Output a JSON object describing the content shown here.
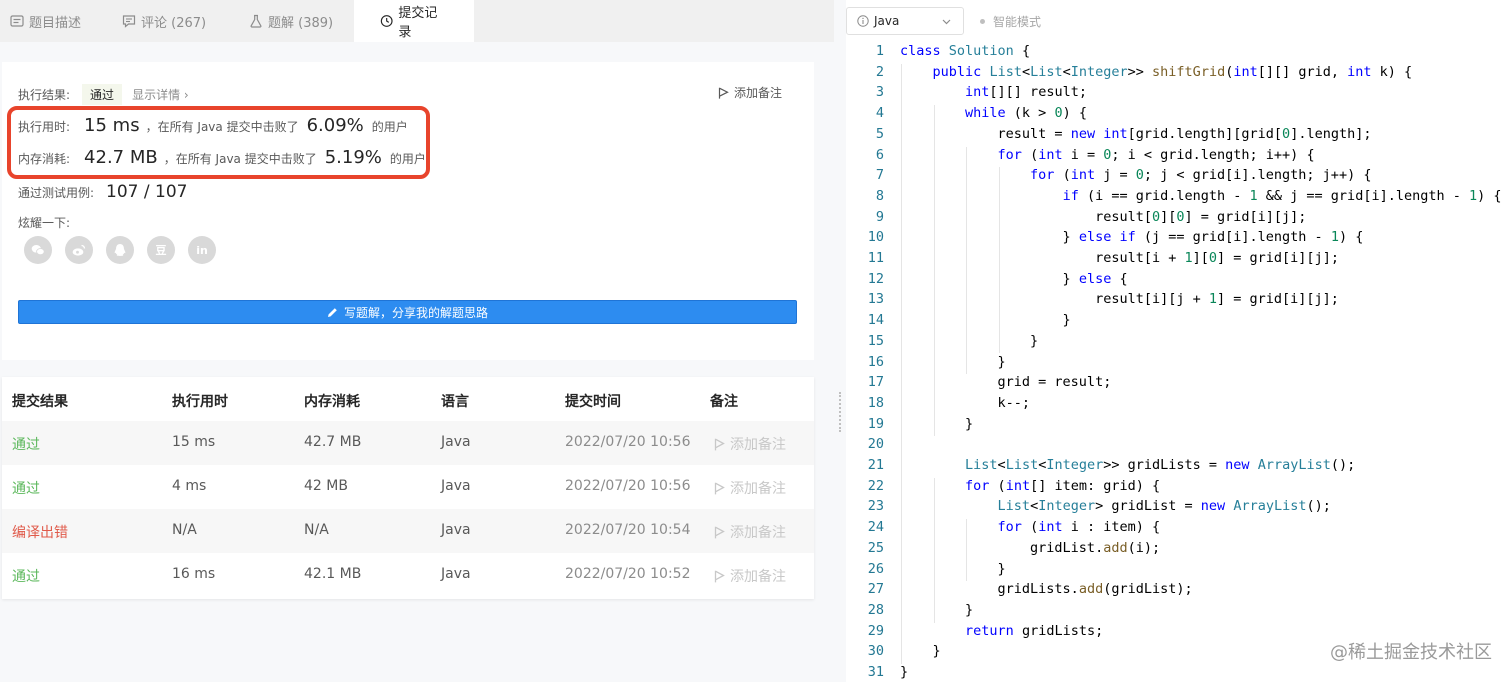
{
  "tabs": [
    {
      "label": "题目描述",
      "icon": "description-icon"
    },
    {
      "label": "评论 (267)",
      "icon": "comment-icon"
    },
    {
      "label": "题解 (389)",
      "icon": "flask-icon"
    },
    {
      "label": "提交记录",
      "icon": "clock-icon"
    }
  ],
  "result": {
    "label": "执行结果:",
    "status": "通过",
    "detail_link": "显示详情 ›",
    "add_note": "添加备注"
  },
  "runtime": {
    "label": "执行用时:",
    "value": "15 ms",
    "text": "，在所有 Java 提交中击败了",
    "percent": "6.09%",
    "suffix": "的用户"
  },
  "memory": {
    "label": "内存消耗:",
    "value": "42.7 MB",
    "text": "，在所有 Java 提交中击败了",
    "percent": "5.19%",
    "suffix": "的用户"
  },
  "testcases": {
    "label": "通过测试用例:",
    "value": "107  /  107"
  },
  "share": {
    "label": "炫耀一下:",
    "icons": [
      "wechat-icon",
      "weibo-icon",
      "qq-icon",
      "douban-icon",
      "linkedin-icon"
    ],
    "douban_glyph": "豆",
    "linkedin_glyph": "in"
  },
  "write_button": "写题解，分享我的解题思路",
  "table": {
    "headers": [
      "提交结果",
      "执行用时",
      "内存消耗",
      "语言",
      "提交时间",
      "备注"
    ],
    "rows": [
      {
        "result": "通过",
        "time": "15 ms",
        "memory": "42.7 MB",
        "lang": "Java",
        "date": "2022/07/20 10:56",
        "note": "添加备注"
      },
      {
        "result": "通过",
        "time": "4 ms",
        "memory": "42 MB",
        "lang": "Java",
        "date": "2022/07/20 10:56",
        "note": "添加备注"
      },
      {
        "result": "编译出错",
        "time": "N/A",
        "memory": "N/A",
        "lang": "Java",
        "date": "2022/07/20 10:54",
        "note": "添加备注"
      },
      {
        "result": "通过",
        "time": "16 ms",
        "memory": "42.1 MB",
        "lang": "Java",
        "date": "2022/07/20 10:52",
        "note": "添加备注"
      }
    ]
  },
  "editor": {
    "language": "Java",
    "smart_mode": "智能模式",
    "lines": [
      "class Solution {",
      "    public List<List<Integer>> shiftGrid(int[][] grid, int k) {",
      "        int[][] result;",
      "        while (k > 0) {",
      "            result = new int[grid.length][grid[0].length];",
      "            for (int i = 0; i < grid.length; i++) {",
      "                for (int j = 0; j < grid[i].length; j++) {",
      "                    if (i == grid.length - 1 && j == grid[i].length - 1) {",
      "                        result[0][0] = grid[i][j];",
      "                    } else if (j == grid[i].length - 1) {",
      "                        result[i + 1][0] = grid[i][j];",
      "                    } else {",
      "                        result[i][j + 1] = grid[i][j];",
      "                    }",
      "                }",
      "            }",
      "            grid = result;",
      "            k--;",
      "        }",
      "",
      "        List<List<Integer>> gridLists = new ArrayList();",
      "        for (int[] item: grid) {",
      "            List<Integer> gridList = new ArrayList();",
      "            for (int i : item) {",
      "                gridList.add(i);",
      "            }",
      "            gridLists.add(gridList);",
      "        }",
      "        return gridLists;",
      "    }",
      "}"
    ]
  },
  "watermark": "@稀土掘金技术社区",
  "colors": {
    "accent": "#2d8cf0",
    "success": "#5cb85c",
    "error": "#e05a4a",
    "highlight_box": "#e8442c",
    "keyword": "#0000ff",
    "type": "#267f99",
    "method": "#795e26",
    "number": "#098658"
  }
}
